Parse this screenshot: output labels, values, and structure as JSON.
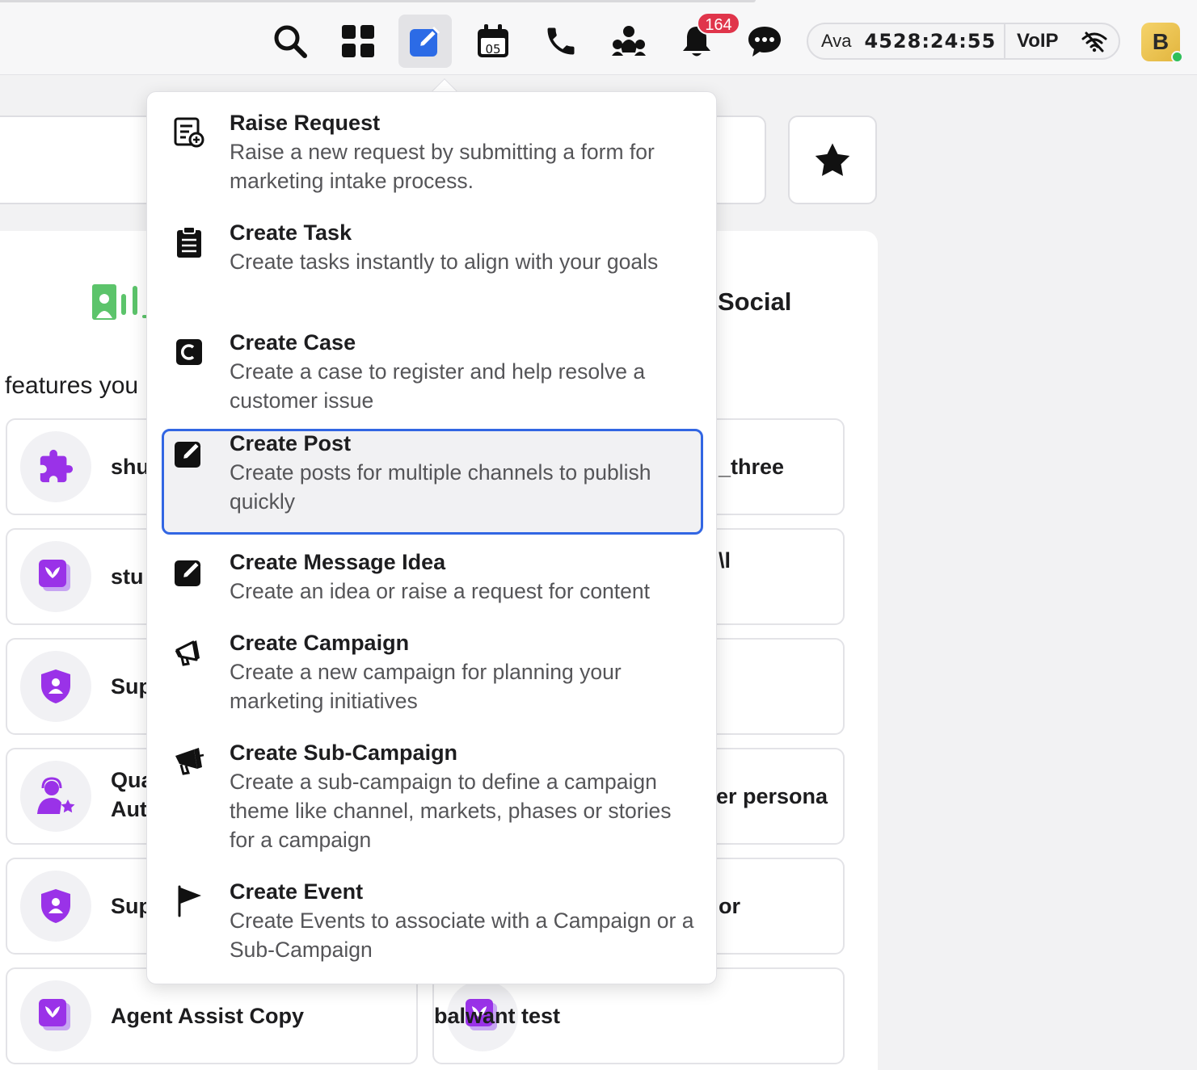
{
  "topbar": {
    "icons": [
      "search-icon",
      "grid-icon",
      "compose-icon",
      "calendar-icon",
      "phone-icon",
      "team-icon",
      "bell-icon",
      "chat-icon"
    ],
    "calendar_day": "05",
    "notification_count": "164",
    "voip": {
      "agent": "Ava",
      "timer": "4528:24:55",
      "label": "VoIP",
      "status_icon": "wifi-off-icon"
    },
    "avatar_initial": "B",
    "accent": "#2c6be6"
  },
  "background": {
    "tab_label": "Social",
    "features_text": "features you",
    "cards_left": [
      {
        "title": "shu",
        "icon": "puzzle-icon"
      },
      {
        "title": "stu",
        "icon": "app-stack-icon"
      },
      {
        "title": "Sup",
        "icon": "shield-user-icon"
      },
      {
        "title": "Qua\nAut",
        "icon": "agent-star-icon"
      },
      {
        "title": "Sup",
        "icon": "shield-user-icon"
      },
      {
        "title": "Agent Assist Copy",
        "icon": "app-stack-icon"
      }
    ],
    "cards_right": [
      {
        "title": "_three"
      },
      {
        "title": "\\l"
      },
      {
        "title": ""
      },
      {
        "title": "er persona"
      },
      {
        "title": "or"
      },
      {
        "title": "balwant test",
        "icon": "app-stack-icon"
      }
    ]
  },
  "menu": {
    "items": [
      {
        "title": "Raise Request",
        "desc": "Raise a new request by submitting a form for marketing intake process.",
        "icon": "form-add-icon"
      },
      {
        "title": "Create Task",
        "desc": "Create tasks instantly to align with your goals",
        "icon": "clipboard-icon"
      },
      {
        "title": "Create Case",
        "desc": "Create a case to register and help resolve a customer issue",
        "icon": "case-icon"
      },
      {
        "title": "Create Post",
        "desc": "Create posts for multiple channels to publish quickly",
        "icon": "edit-square-icon",
        "selected": true
      },
      {
        "title": "Create Message Idea",
        "desc": "Create an idea or raise a request for content",
        "icon": "edit-square-icon"
      },
      {
        "title": "Create Campaign",
        "desc": "Create a new campaign for planning your marketing initiatives",
        "icon": "megaphone-icon"
      },
      {
        "title": "Create Sub-Campaign",
        "desc": "Create a sub-campaign to define a campaign theme like channel, markets, phases or stories for a campaign",
        "icon": "megaphone-filled-icon"
      },
      {
        "title": "Create Event",
        "desc": "Create Events to associate with a Campaign or a Sub-Campaign",
        "icon": "flag-icon"
      }
    ]
  }
}
